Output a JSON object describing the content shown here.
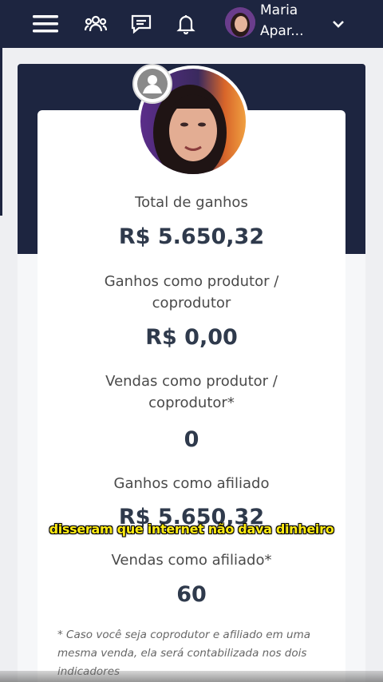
{
  "header": {
    "user_name_line1": "Maria",
    "user_name_line2": "Apar...",
    "icons": [
      "menu-icon",
      "users-icon",
      "chat-icon",
      "bell-icon",
      "chevron-down-icon"
    ]
  },
  "stats": [
    {
      "label_line1": "Total de ganhos",
      "label_line2": "",
      "value": "R$ 5.650,32"
    },
    {
      "label_line1": "Ganhos como produtor /",
      "label_line2": "coprodutor",
      "value": "R$ 0,00"
    },
    {
      "label_line1": "Vendas como produtor /",
      "label_line2": "coprodutor*",
      "value": "0"
    },
    {
      "label_line1": "Ganhos como afiliado",
      "label_line2": "",
      "value": "R$ 5.650,32"
    },
    {
      "label_line1": "Vendas como afiliado*",
      "label_line2": "",
      "value": "60"
    }
  ],
  "footnote": "* Caso você seja coprodutor e afiliado em uma mesma venda, ela será contabilizada nos dois indicadores",
  "subtitle": "disseram que internet não dava dinheiro",
  "colors": {
    "navy": "#1d2540",
    "subtitle_yellow": "#ffeb12",
    "value_text": "#2f3a4c"
  }
}
